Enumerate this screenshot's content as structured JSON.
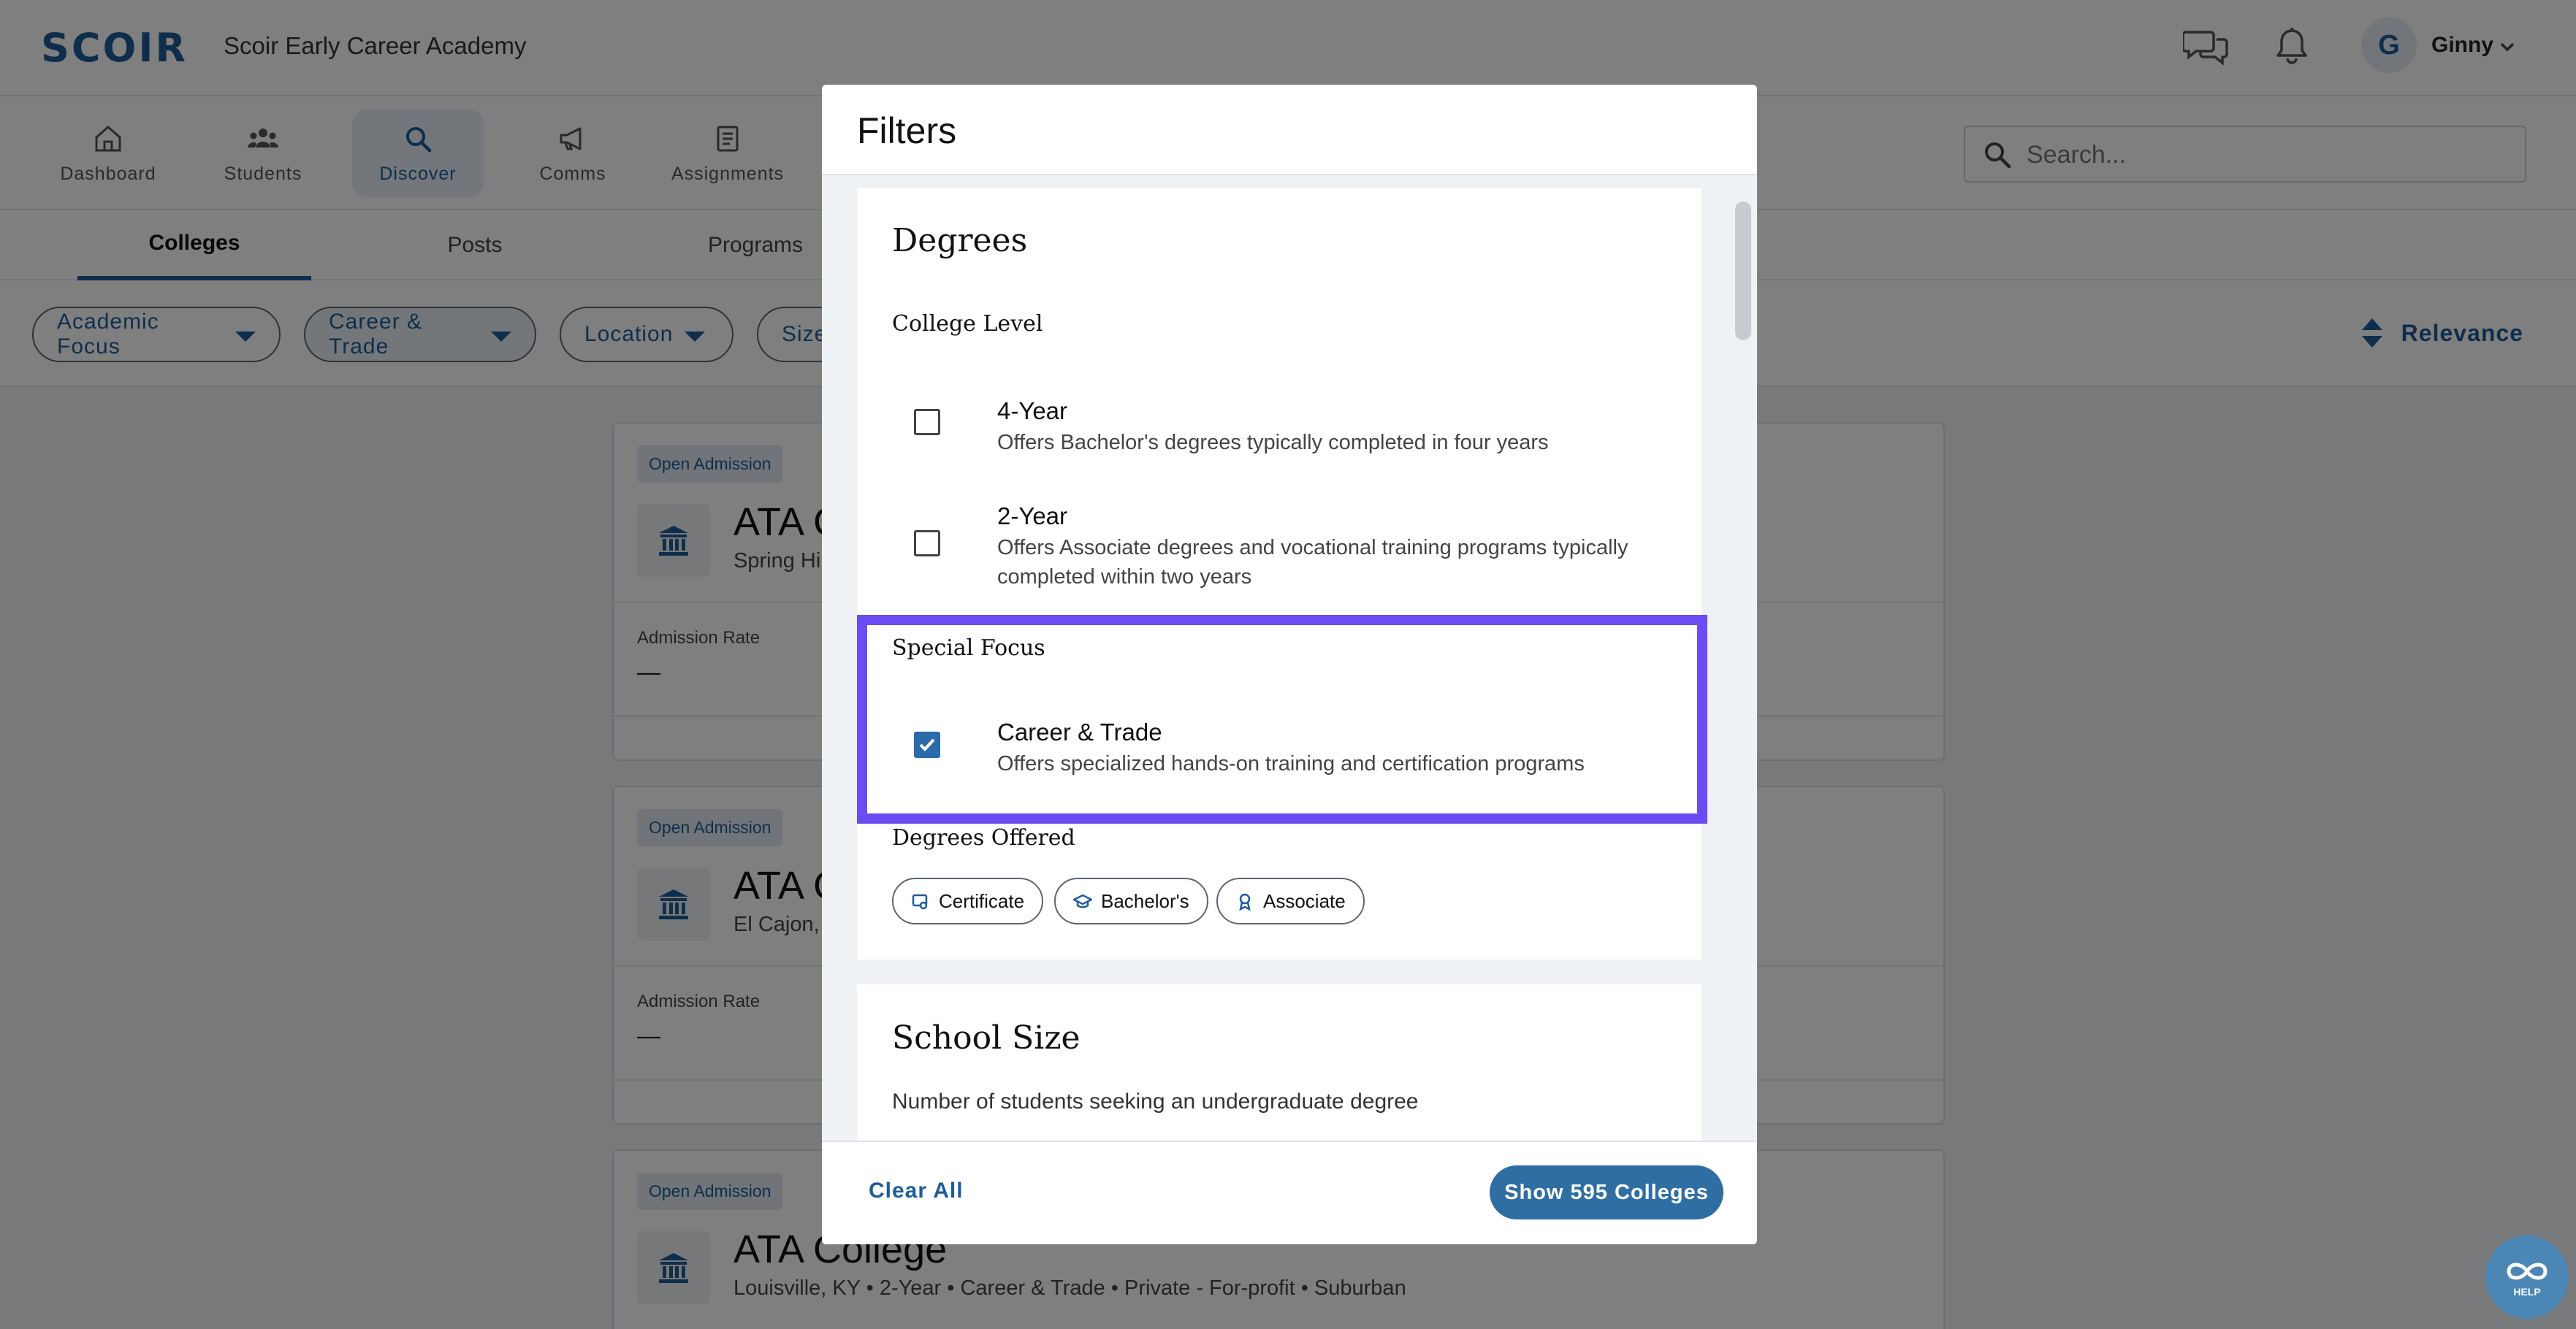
{
  "header": {
    "logo": "SCOIR",
    "org_name": "Scoir Early Career Academy",
    "avatar_initial": "G",
    "user_name": "Ginny"
  },
  "nav": {
    "items": [
      {
        "label": "Dashboard",
        "icon": "home-icon"
      },
      {
        "label": "Students",
        "icon": "students-icon"
      },
      {
        "label": "Discover",
        "icon": "search-icon",
        "active": true
      },
      {
        "label": "Comms",
        "icon": "megaphone-icon"
      },
      {
        "label": "Assignments",
        "icon": "clipboard-icon"
      }
    ],
    "search_placeholder": "Search..."
  },
  "tabs": [
    {
      "label": "Colleges",
      "active": true
    },
    {
      "label": "Posts"
    },
    {
      "label": "Programs"
    }
  ],
  "filters": {
    "pills": [
      "Academic Focus",
      "Career & Trade",
      "Location",
      "Size"
    ],
    "sort_label": "Relevance"
  },
  "colleges": [
    {
      "badge": "Open Admission",
      "name": "ATA C",
      "location": "Spring Hil",
      "rate_label": "Admission Rate",
      "rate_value": "—"
    },
    {
      "badge": "Open Admission",
      "name": "ATA C",
      "location": "El Cajon, C",
      "rate_label": "Admission Rate",
      "rate_value": "—"
    },
    {
      "badge": "Open Admission",
      "name": "ATA College",
      "location": "Louisville, KY • 2-Year • Career & Trade • Private - For-profit • Suburban"
    }
  ],
  "modal": {
    "title": "Filters",
    "degrees": {
      "title": "Degrees",
      "college_level_label": "College Level",
      "options": [
        {
          "title": "4-Year",
          "desc": "Offers Bachelor's degrees typically completed in four years",
          "checked": false
        },
        {
          "title": "2-Year",
          "desc": "Offers Associate degrees and vocational training programs typically completed within two years",
          "checked": false
        }
      ],
      "special_focus_label": "Special Focus",
      "special_option": {
        "title": "Career & Trade",
        "desc": "Offers specialized hands-on training and certification programs",
        "checked": true
      },
      "offered_label": "Degrees Offered",
      "chips": [
        {
          "label": "Certificate",
          "icon": "certificate-icon"
        },
        {
          "label": "Bachelor's",
          "icon": "graduation-cap-icon"
        },
        {
          "label": "Associate",
          "icon": "ribbon-icon"
        }
      ]
    },
    "school_size": {
      "title": "School Size",
      "desc": "Number of students seeking an undergraduate degree"
    },
    "clear_label": "Clear All",
    "show_label": "Show 595 Colleges"
  },
  "help_label": "HELP",
  "colors": {
    "accent": "#1f5c99",
    "highlight": "#6a4cf2",
    "button": "#2f6ea3"
  }
}
